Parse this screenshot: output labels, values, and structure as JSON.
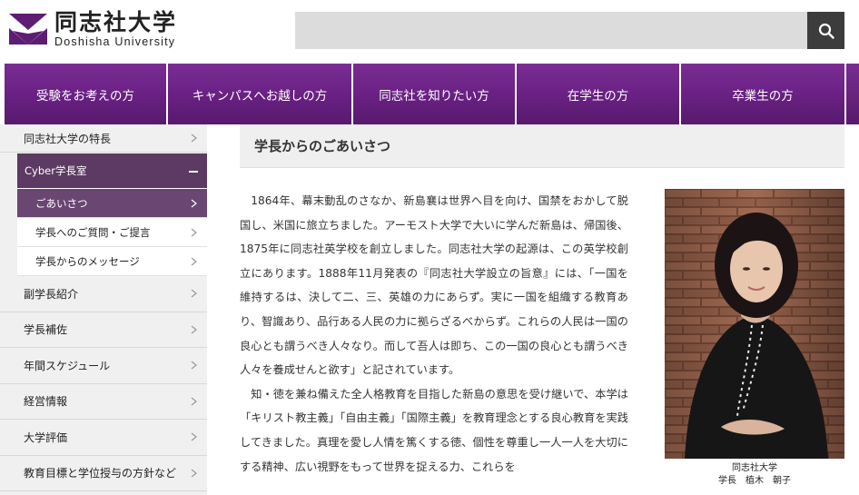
{
  "header": {
    "logo_jp": "同志社大学",
    "logo_en": "Doshisha University",
    "search_placeholder": "",
    "search_label": "検索"
  },
  "nav": {
    "items": [
      {
        "label": "受験をお考えの方"
      },
      {
        "label": "キャンパスへお越しの方"
      },
      {
        "label": "同志社を知りたい方"
      },
      {
        "label": "在学生の方"
      },
      {
        "label": "卒業生の方"
      }
    ]
  },
  "sidebar": {
    "top_item": "同志社大学の特長",
    "section_head": "Cyber学長室",
    "sub_items": [
      {
        "label": "ごあいさつ",
        "active": true
      },
      {
        "label": "学長へのご質問・ご提言",
        "active": false
      },
      {
        "label": "学長からのメッセージ",
        "active": false
      }
    ],
    "items": [
      {
        "label": "副学長紹介"
      },
      {
        "label": "学長補佐"
      },
      {
        "label": "年間スケジュール"
      },
      {
        "label": "経営情報"
      },
      {
        "label": "大学評価"
      },
      {
        "label": "教育目標と学位授与の方針など"
      }
    ]
  },
  "main": {
    "title": "学長からのごあいさつ",
    "paragraphs": [
      "1864年、幕末動乱のさなか、新島襄は世界へ目を向け、国禁をおかして脱国し、米国に旅立ちました。アーモスト大学で大いに学んだ新島は、帰国後、1875年に同志社英学校を創立しました。同志社大学の起源は、この英学校創立にあります。1888年11月発表の『同志社大学設立の旨意』には、「一国を維持するは、決して二、三、英雄の力にあらず。実に一国を組織する教育あり、智識あり、品行ある人民の力に拠らざるべからず。これらの人民は一国の良心とも謂うべき人々なり。而して吾人は即ち、この一国の良心とも謂うべき人々を養成せんと欲す」と記されています。",
      "知・徳を兼ね備えた全人格教育を目指した新島の意思を受け継いで、本学は「キリスト教主義」「自由主義」「国際主義」を教育理念とする良心教育を実践してきました。真理を愛し人情を篤くする徳、個性を尊重し一人一人を大切にする精神、広い視野をもって世界を捉える力、これらを"
    ],
    "caption_line1": "同志社大学",
    "caption_line2": "学長　植木　朝子"
  },
  "colors": {
    "brand_purple": "#5d1d72",
    "sidebar_head": "#5c3a63",
    "sidebar_active": "#6a4672",
    "search_button": "#3c3c3c"
  }
}
